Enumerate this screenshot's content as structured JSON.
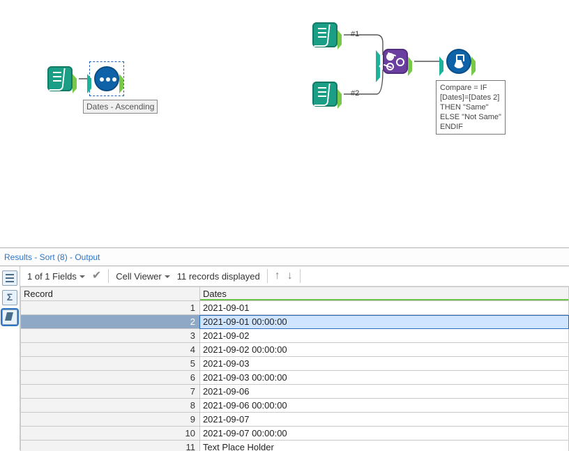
{
  "canvas": {
    "sort_label": "Dates - Ascending",
    "tag1": "#1",
    "tag2": "#2",
    "formula_annot": [
      "Compare = IF",
      "[Dates]=[Dates 2]",
      "THEN \"Same\"",
      "ELSE \"Not Same\"",
      "ENDIF"
    ]
  },
  "results_header": "Results - Sort (8) - Output",
  "toolbar": {
    "fields": "1 of 1 Fields",
    "cell_viewer": "Cell Viewer",
    "records": "11 records displayed"
  },
  "grid": {
    "headers": {
      "record": "Record",
      "dates": "Dates"
    },
    "rows": [
      {
        "n": "1",
        "v": "2021-09-01"
      },
      {
        "n": "2",
        "v": "2021-09-01 00:00:00",
        "selected": true
      },
      {
        "n": "3",
        "v": "2021-09-02"
      },
      {
        "n": "4",
        "v": "2021-09-02 00:00:00"
      },
      {
        "n": "5",
        "v": "2021-09-03"
      },
      {
        "n": "6",
        "v": "2021-09-03 00:00:00"
      },
      {
        "n": "7",
        "v": "2021-09-06"
      },
      {
        "n": "8",
        "v": "2021-09-06 00:00:00"
      },
      {
        "n": "9",
        "v": "2021-09-07"
      },
      {
        "n": "10",
        "v": "2021-09-07 00:00:00"
      },
      {
        "n": "11",
        "v": "Text Place Holder"
      }
    ]
  }
}
